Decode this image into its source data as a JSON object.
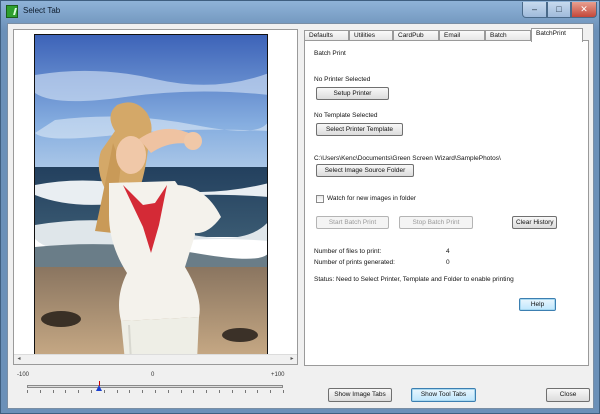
{
  "window": {
    "title": "Select Tab",
    "min_glyph": "–",
    "max_glyph": "□",
    "close_glyph": "✕"
  },
  "scroll": {
    "left_glyph": "◂",
    "right_glyph": "▸"
  },
  "slider": {
    "min_label": "-100",
    "mid_label": "0",
    "max_label": "+100",
    "value": -43
  },
  "tabs": [
    {
      "label": "Defaults",
      "active": false
    },
    {
      "label": "Utilities",
      "active": false
    },
    {
      "label": "CardPub",
      "active": false
    },
    {
      "label": "Email",
      "active": false
    },
    {
      "label": "Batch",
      "active": false
    },
    {
      "label": "BatchPrint",
      "active": true
    }
  ],
  "batch_print": {
    "heading": "Batch Print",
    "printer_status": "No Printer Selected",
    "setup_printer_label": "Setup Printer",
    "template_status": "No Template Selected",
    "select_template_label": "Select Printer Template",
    "folder_path": "C:\\Users\\Kenc\\Documents\\Green Screen Wizard\\SamplePhotos\\",
    "select_folder_label": "Select Image Source Folder",
    "watch_label": "Watch for new images in folder",
    "watch_checked": false,
    "start_label": "Start Batch Print",
    "stop_label": "Stop Batch Print",
    "clear_label": "Clear History",
    "files_label": "Number of files to print:",
    "files_value": "4",
    "prints_label": "Number of prints generated:",
    "prints_value": "0",
    "status_text": "Status:  Need to Select Printer, Template and Folder to enable printing",
    "help_label": "Help"
  },
  "footer": {
    "show_image_tabs": "Show Image Tabs",
    "show_tool_tabs": "Show Tool Tabs",
    "close_label": "Close"
  }
}
